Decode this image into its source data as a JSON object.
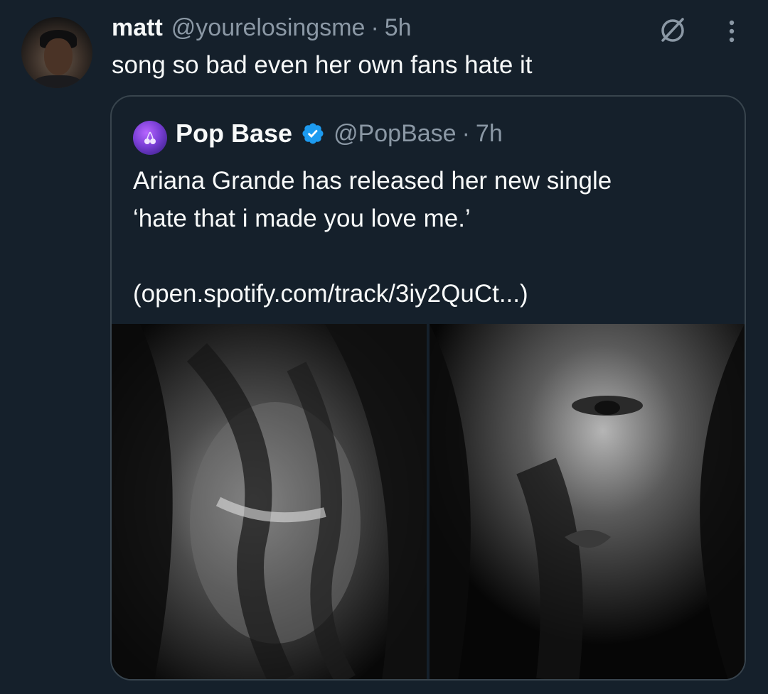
{
  "tweet": {
    "display_name": "matt",
    "handle": "@yourelosingsme",
    "separator": "·",
    "time": "5h",
    "text": "song so bad even her own fans hate it",
    "icons": {
      "grok": "grok-slash-icon",
      "more": "more-vertical-icon"
    }
  },
  "quote": {
    "display_name": "Pop Base",
    "handle": "@PopBase",
    "separator": "·",
    "time": "7h",
    "verified": true,
    "text_line1": "Ariana Grande has released her new single",
    "text_line2": "‘hate that i made you love me.’",
    "link": "(open.spotify.com/track/3iy2QuCt...)",
    "media": [
      {
        "description_icon": "photo-icon"
      },
      {
        "description_icon": "photo-icon"
      }
    ]
  },
  "colors": {
    "background": "#15202b",
    "text": "#f7f9f9",
    "secondary_text": "#8b98a5",
    "border": "#38444d",
    "verified": "#1d9bf0"
  }
}
